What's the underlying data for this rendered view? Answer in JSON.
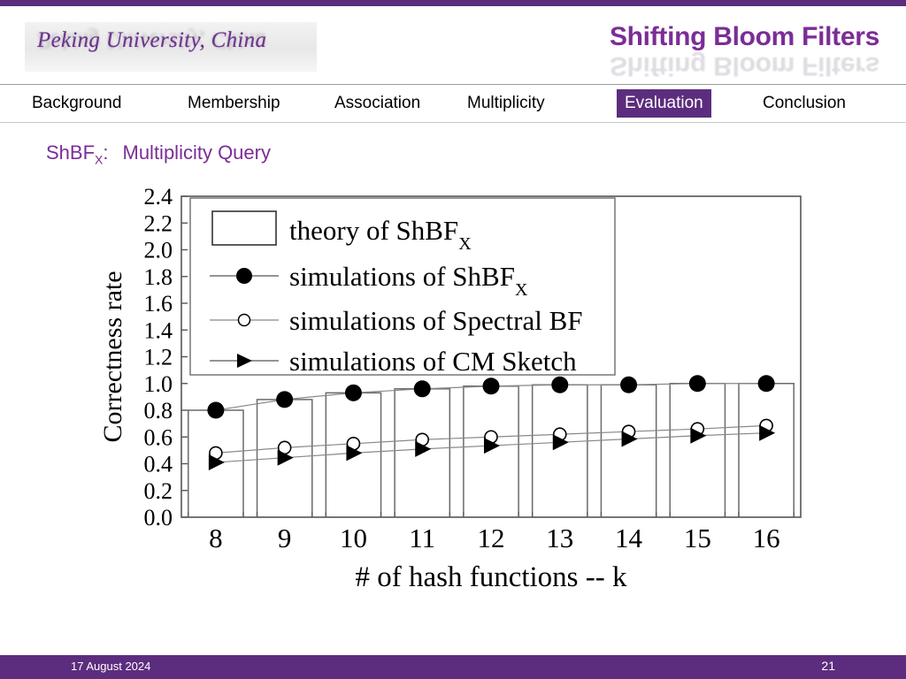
{
  "theme": {
    "accent_purple": "#5C2D7E",
    "title_purple": "#7B2D96",
    "nav_active_bg": "#5C2D7E",
    "nav_active_fg": "#FFFFFF",
    "page_bg": "#FFFFFF"
  },
  "header": {
    "logo_text": "Peking University, China",
    "title": "Shifting Bloom Filters"
  },
  "nav": {
    "items": [
      {
        "label": "Background",
        "active": false
      },
      {
        "label": "Membership",
        "active": false
      },
      {
        "label": "Association",
        "active": false
      },
      {
        "label": "Multiplicity",
        "active": false
      },
      {
        "label": "Evaluation",
        "active": true
      },
      {
        "label": "Conclusion",
        "active": false
      }
    ]
  },
  "subtitle": {
    "prefix": "ShBF",
    "subscript": "X",
    "colon": ":",
    "text": "Multiplicity Query"
  },
  "footer": {
    "date": "17 August 2024",
    "page_number": "21"
  },
  "chart_data": {
    "type": "bar",
    "title": "",
    "xlabel": "# of hash functions -- k",
    "ylabel": "Correctness rate",
    "categories": [
      "8",
      "9",
      "10",
      "11",
      "12",
      "13",
      "14",
      "15",
      "16"
    ],
    "ylim": [
      0.0,
      2.4
    ],
    "yticks": [
      "0.0",
      "0.2",
      "0.4",
      "0.6",
      "0.8",
      "1.0",
      "1.2",
      "1.4",
      "1.6",
      "1.8",
      "2.0",
      "2.2",
      "2.4"
    ],
    "ytick_values": [
      0.0,
      0.2,
      0.4,
      0.6,
      0.8,
      1.0,
      1.2,
      1.4,
      1.6,
      1.8,
      2.0,
      2.2,
      2.4
    ],
    "grid": false,
    "legend_position": "upper-left-inside",
    "series": [
      {
        "name": "theory of ShBF",
        "name_subscript": "X",
        "marker": "bar",
        "style": "open-rectangle",
        "values": [
          0.8,
          0.88,
          0.93,
          0.96,
          0.98,
          0.99,
          0.99,
          1.0,
          1.0
        ]
      },
      {
        "name": "simulations of ShBF",
        "name_subscript": "X",
        "marker": "filled-circle",
        "style": "line-filled-circle",
        "values": [
          0.8,
          0.88,
          0.93,
          0.96,
          0.98,
          0.99,
          0.99,
          1.0,
          1.0
        ]
      },
      {
        "name": "simulations of Spectral BF",
        "name_subscript": "",
        "marker": "open-circle",
        "style": "line-open-circle",
        "values": [
          0.48,
          0.52,
          0.55,
          0.58,
          0.6,
          0.62,
          0.64,
          0.66,
          0.685
        ]
      },
      {
        "name": "simulations of CM Sketch",
        "name_subscript": "",
        "marker": "filled-triangle",
        "style": "line-filled-triangle",
        "values": [
          0.41,
          0.445,
          0.48,
          0.51,
          0.535,
          0.56,
          0.585,
          0.61,
          0.63
        ]
      }
    ]
  }
}
